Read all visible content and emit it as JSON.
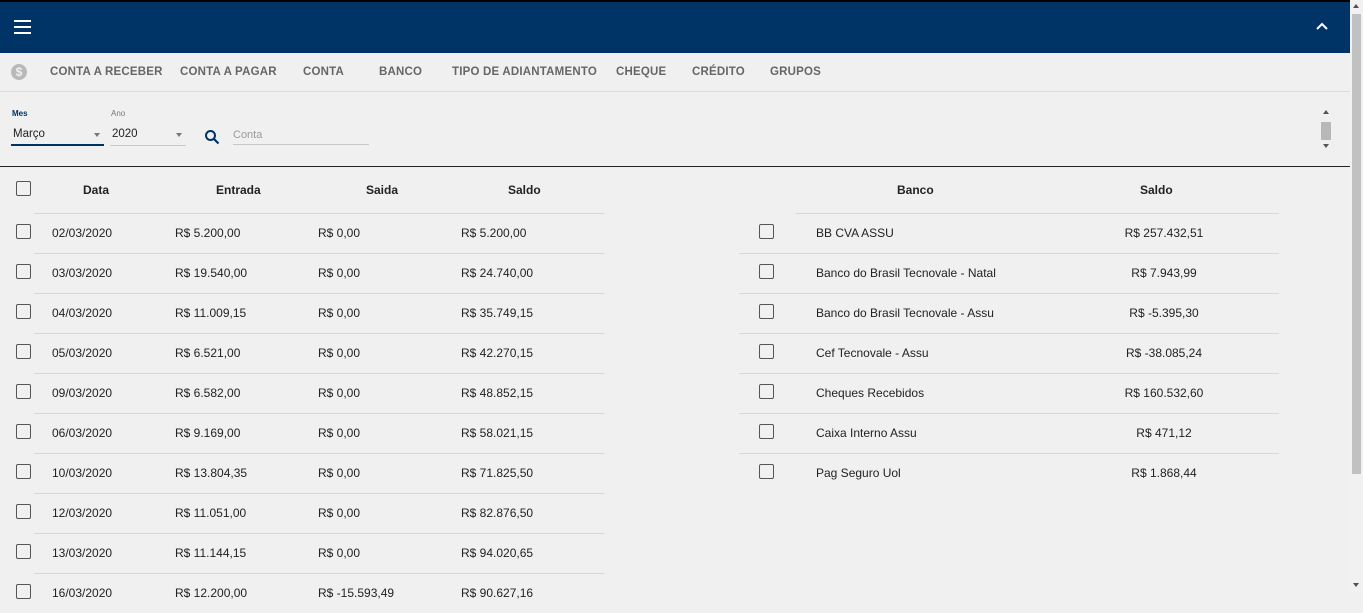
{
  "header": {
    "menu_icon": "menu-icon",
    "collapse_icon": "chevron-up-icon",
    "bg_color": "#003366"
  },
  "tabs": [
    {
      "label": "CONTA A RECEBER"
    },
    {
      "label": "CONTA A PAGAR"
    },
    {
      "label": "CONTA"
    },
    {
      "label": "BANCO"
    },
    {
      "label": "TIPO DE ADIANTAMENTO"
    },
    {
      "label": "CHEQUE"
    },
    {
      "label": "CRÉDITO"
    },
    {
      "label": "GRUPOS"
    }
  ],
  "filters": {
    "month_label": "Mes",
    "month_value": "Março",
    "year_label": "Ano",
    "year_value": "2020",
    "search_placeholder": "Conta"
  },
  "left_table": {
    "headers": [
      "Data",
      "Entrada",
      "Saida",
      "Saldo"
    ],
    "rows": [
      [
        "02/03/2020",
        "R$ 5.200,00",
        "R$ 0,00",
        "R$ 5.200,00"
      ],
      [
        "03/03/2020",
        "R$ 19.540,00",
        "R$ 0,00",
        "R$ 24.740,00"
      ],
      [
        "04/03/2020",
        "R$ 11.009,15",
        "R$ 0,00",
        "R$ 35.749,15"
      ],
      [
        "05/03/2020",
        "R$ 6.521,00",
        "R$ 0,00",
        "R$ 42.270,15"
      ],
      [
        "09/03/2020",
        "R$ 6.582,00",
        "R$ 0,00",
        "R$ 48.852,15"
      ],
      [
        "06/03/2020",
        "R$ 9.169,00",
        "R$ 0,00",
        "R$ 58.021,15"
      ],
      [
        "10/03/2020",
        "R$ 13.804,35",
        "R$ 0,00",
        "R$ 71.825,50"
      ],
      [
        "12/03/2020",
        "R$ 11.051,00",
        "R$ 0,00",
        "R$ 82.876,50"
      ],
      [
        "13/03/2020",
        "R$ 11.144,15",
        "R$ 0,00",
        "R$ 94.020,65"
      ],
      [
        "16/03/2020",
        "R$ 12.200,00",
        "R$ -15.593,49",
        "R$ 90.627,16"
      ]
    ]
  },
  "right_table": {
    "headers": [
      "Banco",
      "Saldo"
    ],
    "rows": [
      [
        "BB CVA ASSU",
        "R$ 257.432,51"
      ],
      [
        "Banco do Brasil Tecnovale - Natal",
        "R$ 7.943,99"
      ],
      [
        "Banco do Brasil Tecnovale - Assu",
        "R$ -5.395,30"
      ],
      [
        "Cef Tecnovale - Assu",
        "R$ -38.085,24"
      ],
      [
        "Cheques Recebidos",
        "R$ 160.532,60"
      ],
      [
        "Caixa Interno Assu",
        "R$ 471,12"
      ],
      [
        "Pag Seguro Uol",
        "R$ 1.868,44"
      ]
    ]
  }
}
